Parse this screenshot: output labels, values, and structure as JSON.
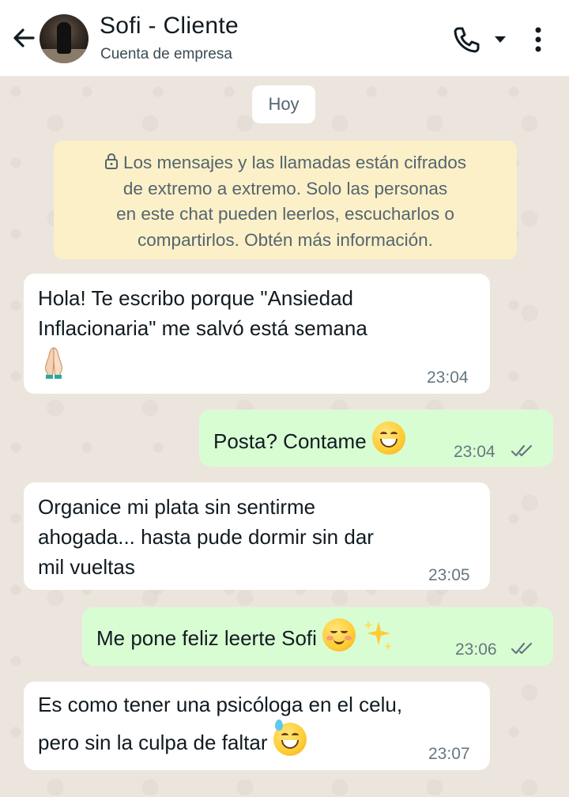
{
  "header": {
    "contact_name": "Sofi - Cliente",
    "contact_subtitle": "Cuenta de empresa"
  },
  "chat": {
    "date_chip": "Hoy",
    "encryption_notice": {
      "lines": [
        "Los mensajes y las llamadas están cifrados",
        "de extremo a extremo. Solo las personas",
        "en este chat pueden leerlos, escucharlos o",
        "compartirlos. Obtén más información."
      ]
    },
    "messages": [
      {
        "direction": "incoming",
        "lines": [
          "Hola! Te escribo porque \"Ansiedad",
          "Inflacionaria\" me salvó está semana"
        ],
        "emoji": "folded-hands",
        "time": "23:04"
      },
      {
        "direction": "outgoing",
        "text": "Posta? Contame",
        "emoji": "grinning-face",
        "time": "23:04",
        "status": "read"
      },
      {
        "direction": "incoming",
        "lines": [
          "Organice mi plata sin sentirme",
          "ahogada... hasta pude dormir sin dar",
          "mil vueltas"
        ],
        "time": "23:05"
      },
      {
        "direction": "outgoing",
        "text": "Me pone feliz leerte Sofi",
        "emoji": "smiling-face-sparkles",
        "time": "23:06",
        "status": "read"
      },
      {
        "direction": "incoming",
        "lines": [
          "Es como tener una psicóloga en el celu,",
          "pero sin la culpa de faltar"
        ],
        "emoji": "grinning-sweat",
        "time": "23:07"
      }
    ]
  },
  "colors": {
    "header_bg": "#ffffff",
    "chat_bg": "#ece5dd",
    "incoming_bubble": "#ffffff",
    "outgoing_bubble": "#d9fdd3",
    "notice_bg": "#fcf0c8",
    "time_text": "#667781"
  }
}
